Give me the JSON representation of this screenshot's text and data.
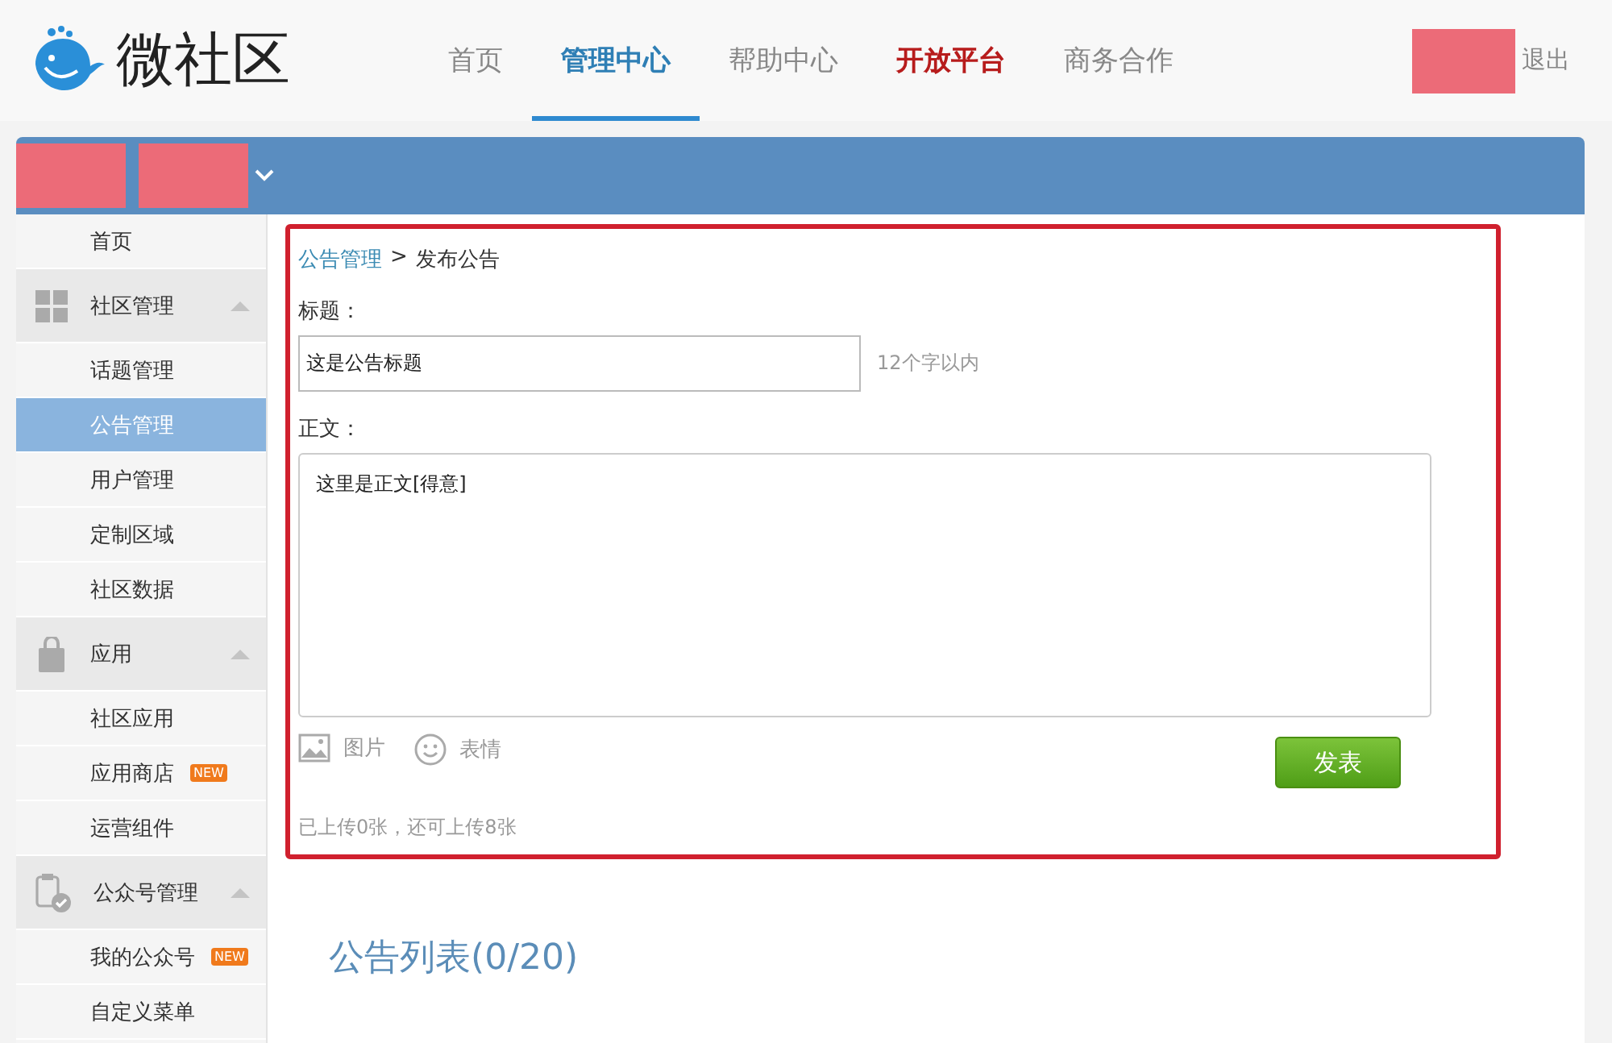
{
  "header": {
    "logo_text": "微社区",
    "nav": [
      {
        "label": "首页",
        "selected": false,
        "highlight": false
      },
      {
        "label": "管理中心",
        "selected": true,
        "highlight": false
      },
      {
        "label": "帮助中心",
        "selected": false,
        "highlight": false
      },
      {
        "label": "开放平台",
        "selected": false,
        "highlight": true
      },
      {
        "label": "商务合作",
        "selected": false,
        "highlight": false
      }
    ],
    "logout": "退出"
  },
  "sidebar": [
    {
      "kind": "item",
      "label": "首页",
      "selected": false
    },
    {
      "kind": "group",
      "label": "社区管理",
      "expanded": true,
      "children": [
        {
          "label": "话题管理",
          "selected": false
        },
        {
          "label": "公告管理",
          "selected": true
        },
        {
          "label": "用户管理",
          "selected": false
        },
        {
          "label": "定制区域",
          "selected": false
        },
        {
          "label": "社区数据",
          "selected": false
        }
      ]
    },
    {
      "kind": "group",
      "label": "应用",
      "expanded": true,
      "children": [
        {
          "label": "社区应用",
          "selected": false
        },
        {
          "label": "应用商店",
          "selected": false,
          "badge": "NEW"
        },
        {
          "label": "运营组件",
          "selected": false
        }
      ]
    },
    {
      "kind": "group",
      "label": "公众号管理",
      "expanded": true,
      "children": [
        {
          "label": "我的公众号",
          "selected": false,
          "badge": "NEW"
        },
        {
          "label": "自定义菜单",
          "selected": false
        }
      ]
    }
  ],
  "form": {
    "breadcrumb": {
      "link": "公告管理",
      "separator": ">",
      "current": "发布公告"
    },
    "title_label": "标题：",
    "title_value": "这是公告标题",
    "title_hint": "12个字以内",
    "body_label": "正文：",
    "body_value": "这里是正文[得意]",
    "tools": [
      "图片",
      "表情"
    ],
    "submit": "发表",
    "upload_status": "已上传0张，还可上传8张"
  },
  "list_title": "公告列表(0/20)"
}
